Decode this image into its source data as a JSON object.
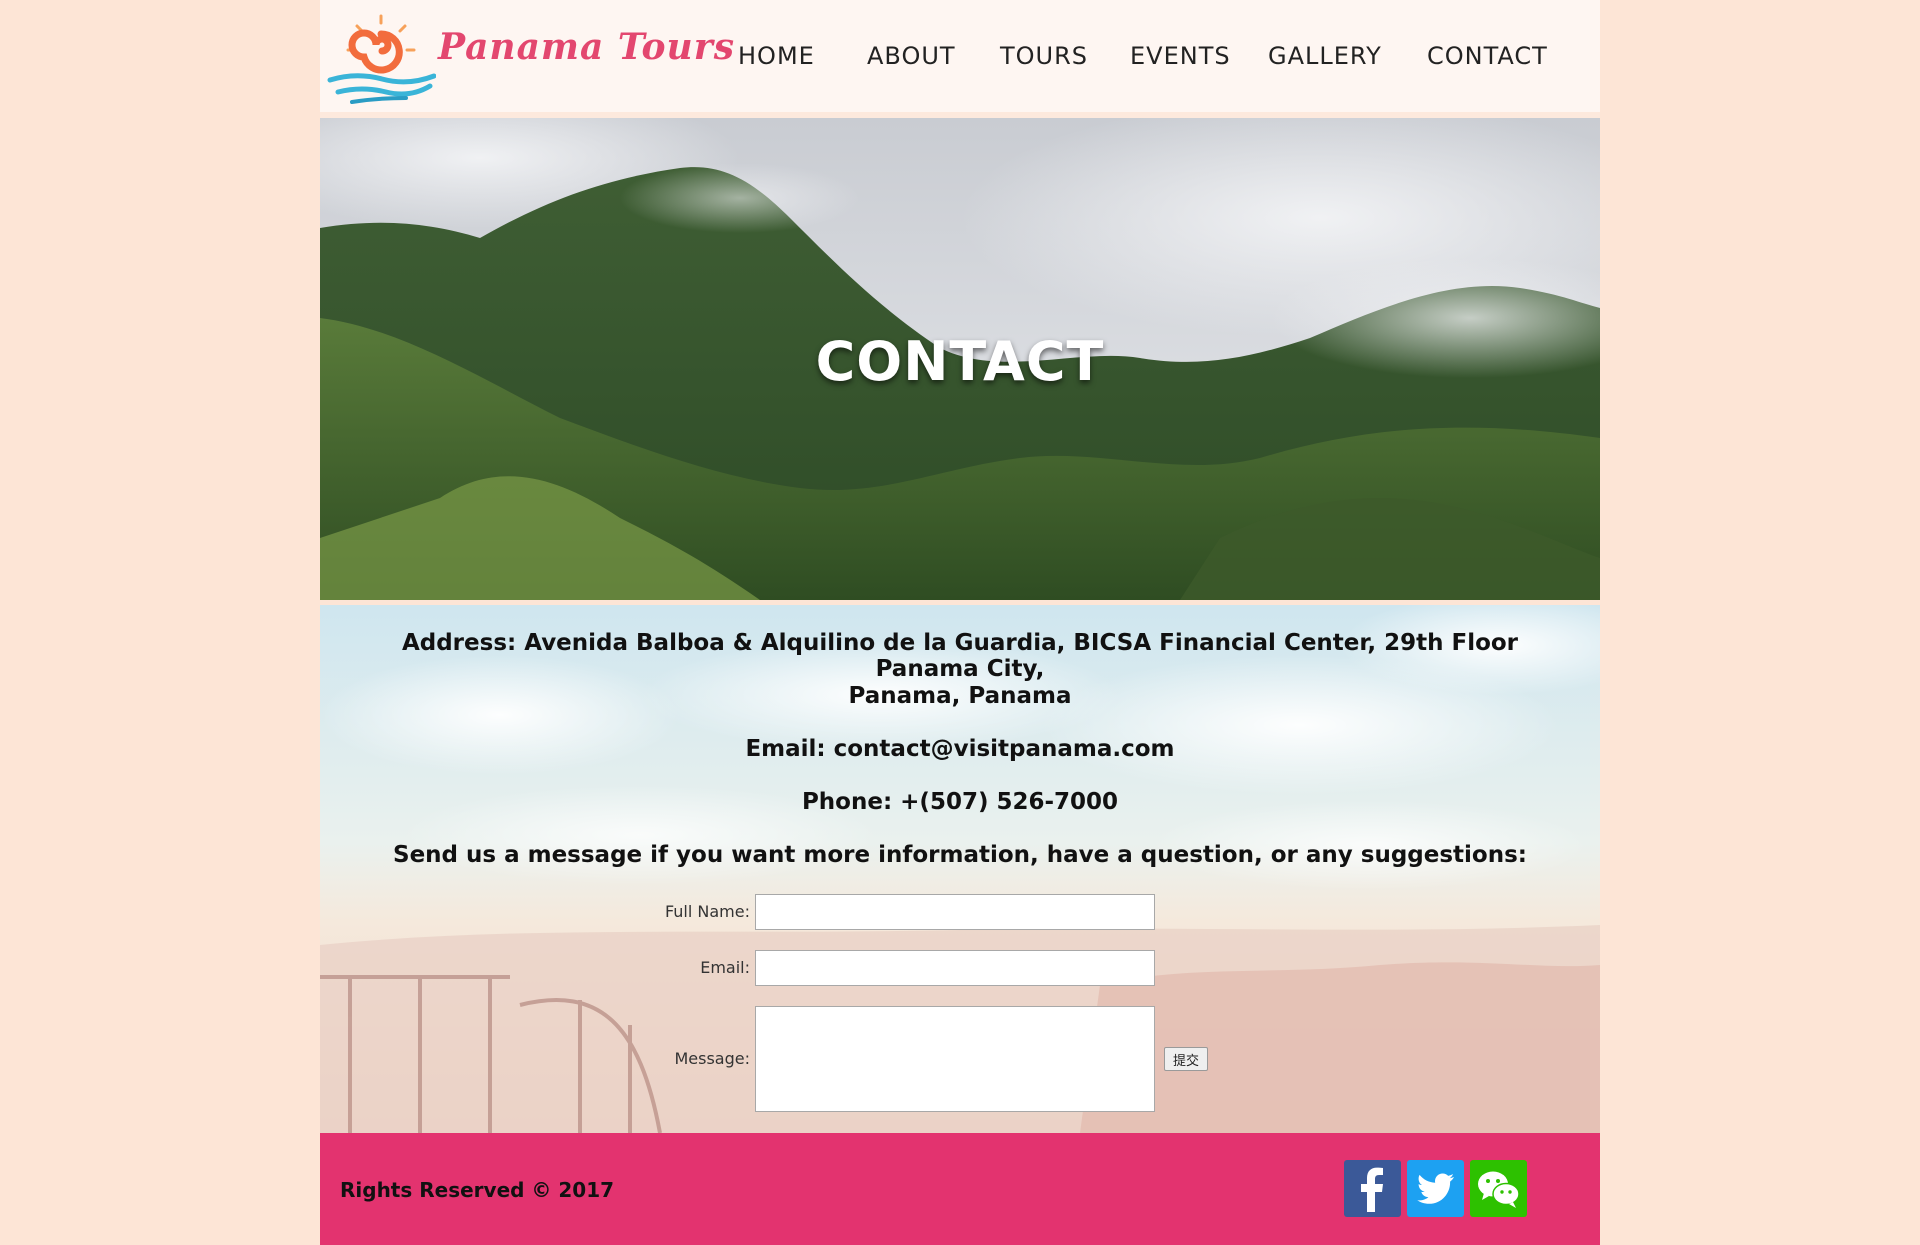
{
  "header": {
    "logo_text": "Panama Tours",
    "nav": [
      "HOME",
      "ABOUT",
      "TOURS",
      "EVENTS",
      "GALLERY",
      "CONTACT"
    ]
  },
  "hero": {
    "title": "CONTACT"
  },
  "contact": {
    "address_line1": "Address: Avenida Balboa & Alquilino de la Guardia, BICSA Financial Center, 29th Floor Panama City,",
    "address_line2": "Panama, Panama",
    "email": "Email: contact@visitpanama.com",
    "phone": "Phone: +(507) 526-7000",
    "message_prompt": "Send us a message if you want more information, have a question, or any suggestions:"
  },
  "form": {
    "full_name_label": "Full Name:",
    "email_label": "Email:",
    "message_label": "Message:",
    "full_name_value": "",
    "email_value": "",
    "message_value": "",
    "submit_label": "提交"
  },
  "footer": {
    "copyright": "Rights Reserved © 2017",
    "social": [
      "facebook-icon",
      "twitter-icon",
      "wechat-icon"
    ]
  },
  "colors": {
    "page_bg": "#fde5d6",
    "header_bg": "#fef6f2",
    "brand_pink": "#e3476f",
    "footer_bg": "#e3336f",
    "facebook": "#3b5998",
    "twitter": "#1da1f2",
    "wechat": "#2dc100"
  }
}
